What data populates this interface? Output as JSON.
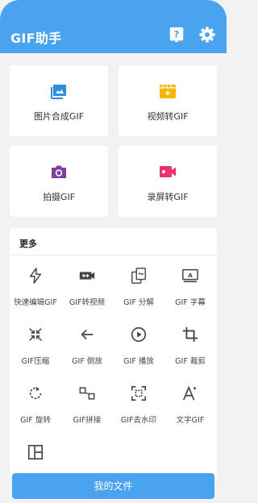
{
  "appbar": {
    "title": "GIF助手",
    "icons": [
      "help-icon",
      "gear-icon"
    ]
  },
  "cards": [
    {
      "label": "图片合成GIF",
      "icon": "image-icon",
      "color": "#2f8fdc"
    },
    {
      "label": "视频转GIF",
      "icon": "video-sparkle-icon",
      "color": "#f5b400"
    },
    {
      "label": "拍摄GIF",
      "icon": "camera-icon",
      "color": "#7e3ea5"
    },
    {
      "label": "录屏转GIF",
      "icon": "record-screen-icon",
      "color": "#e8336c"
    }
  ],
  "more": {
    "title": "更多",
    "tools": [
      {
        "label": "快速编辑GIF",
        "icon": "flash-icon"
      },
      {
        "label": "GIF转视频",
        "icon": "video-convert-icon"
      },
      {
        "label": "GIF 分解",
        "icon": "split-icon"
      },
      {
        "label": "GIF 字幕",
        "icon": "subtitle-icon"
      },
      {
        "label": "GIF压缩",
        "icon": "compress-icon"
      },
      {
        "label": "GIF 倒放",
        "icon": "reverse-icon"
      },
      {
        "label": "GIF 播放",
        "icon": "play-icon"
      },
      {
        "label": "GIF 裁剪",
        "icon": "crop-icon"
      },
      {
        "label": "GIF 旋转",
        "icon": "rotate-icon"
      },
      {
        "label": "GIF拼接",
        "icon": "join-icon"
      },
      {
        "label": "GIF去水印",
        "icon": "remove-watermark-icon"
      },
      {
        "label": "文字GIF",
        "icon": "text-icon"
      },
      {
        "label": "",
        "icon": "layout-icon"
      }
    ]
  },
  "bottom_button": {
    "label": "我的文件"
  },
  "colors": {
    "primary": "#4aa3ef",
    "background": "#f2f2f2",
    "icon_gray": "#444444"
  }
}
